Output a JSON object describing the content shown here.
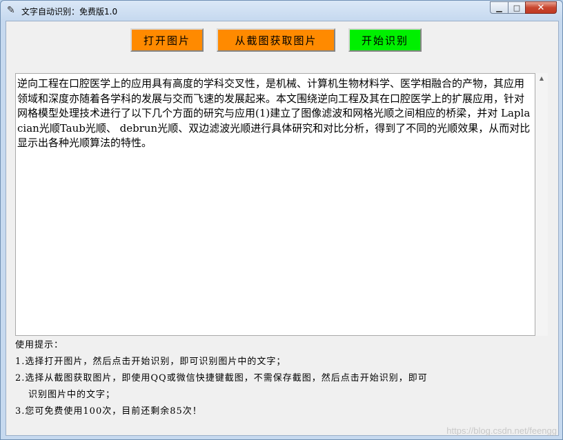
{
  "window": {
    "title": "文字自动识别：免费版1.0",
    "controls": {
      "minimize": "▁",
      "maximize": "□",
      "close": "✕"
    }
  },
  "toolbar": {
    "open_label": "打开图片",
    "screenshot_label": "从截图获取图片",
    "start_label": "开始识别",
    "colors": {
      "orange": "#ff8a00",
      "green": "#00f000"
    }
  },
  "result": {
    "text": "逆向工程在口腔医学上的应用具有高度的学科交叉性，是机械、计算机生物材料学、医学相融合的产物，其应用领域和深度亦随着各学科的发展与交而飞速的发展起来。本文围绕逆向工程及其在口腔医学上的扩展应用，针对网格模型处理技术进行了以下几个方面的研究与应用(1)建立了图像滤波和网格光顺之间相应的桥梁，并对 Laplacian光顺Taub光顺、 debrun光顺、双边滤波光顺进行具体研究和对比分析，得到了不同的光顺效果，从而对比显示出各种光顺算法的特性。"
  },
  "tips": {
    "heading": "使用提示：",
    "line1": "1.选择打开图片，然后点击开始识别，即可识别图片中的文字；",
    "line2a": "2.选择从截图获取图片，即使用QQ或微信快捷键截图，不需保存截图，然后点击开始识别，即可",
    "line2b": "识别图片中的文字；",
    "line3": "3.您可免费使用100次，目前还剩余85次！"
  },
  "watermark": "https://blog.csdn.net/feengg"
}
